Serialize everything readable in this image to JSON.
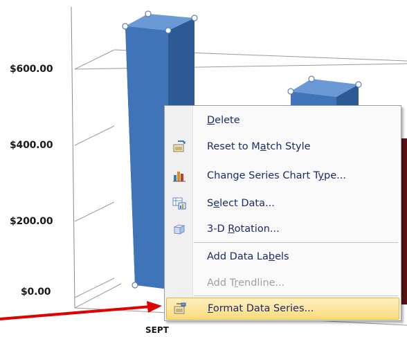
{
  "chart": {
    "y_ticks": [
      "$600.00",
      "$400.00",
      "$200.00",
      "$0.00"
    ],
    "categories": [
      "SEPT"
    ],
    "bar_color": "#3f74b8",
    "bar_dark": "#2b5a95",
    "bar_light": "#5d90d2"
  },
  "menu": {
    "items": [
      {
        "pre": "",
        "ul": "D",
        "post": "elete",
        "icon": "none",
        "enabled": true
      },
      {
        "pre": "Reset to M",
        "ul": "a",
        "post": "tch Style",
        "icon": "reset-style-icon",
        "enabled": true
      },
      {
        "pre": "Change Series Chart T",
        "ul": "y",
        "post": "pe...",
        "icon": "chart-type-icon",
        "enabled": true
      },
      {
        "pre": "S",
        "ul": "e",
        "post": "lect Data...",
        "icon": "select-data-icon",
        "enabled": true
      },
      {
        "pre": "3-D ",
        "ul": "R",
        "post": "otation...",
        "icon": "rotation-3d-icon",
        "enabled": true
      },
      {
        "pre": "Add Data La",
        "ul": "b",
        "post": "els",
        "icon": "none",
        "enabled": true
      },
      {
        "pre": "Add T",
        "ul": "r",
        "post": "endline...",
        "icon": "none",
        "enabled": false
      },
      {
        "pre": "",
        "ul": "F",
        "post": "ormat Data Series...",
        "icon": "format-series-icon",
        "enabled": true
      }
    ]
  },
  "annotation": {
    "arrow_color": "#e00000"
  }
}
